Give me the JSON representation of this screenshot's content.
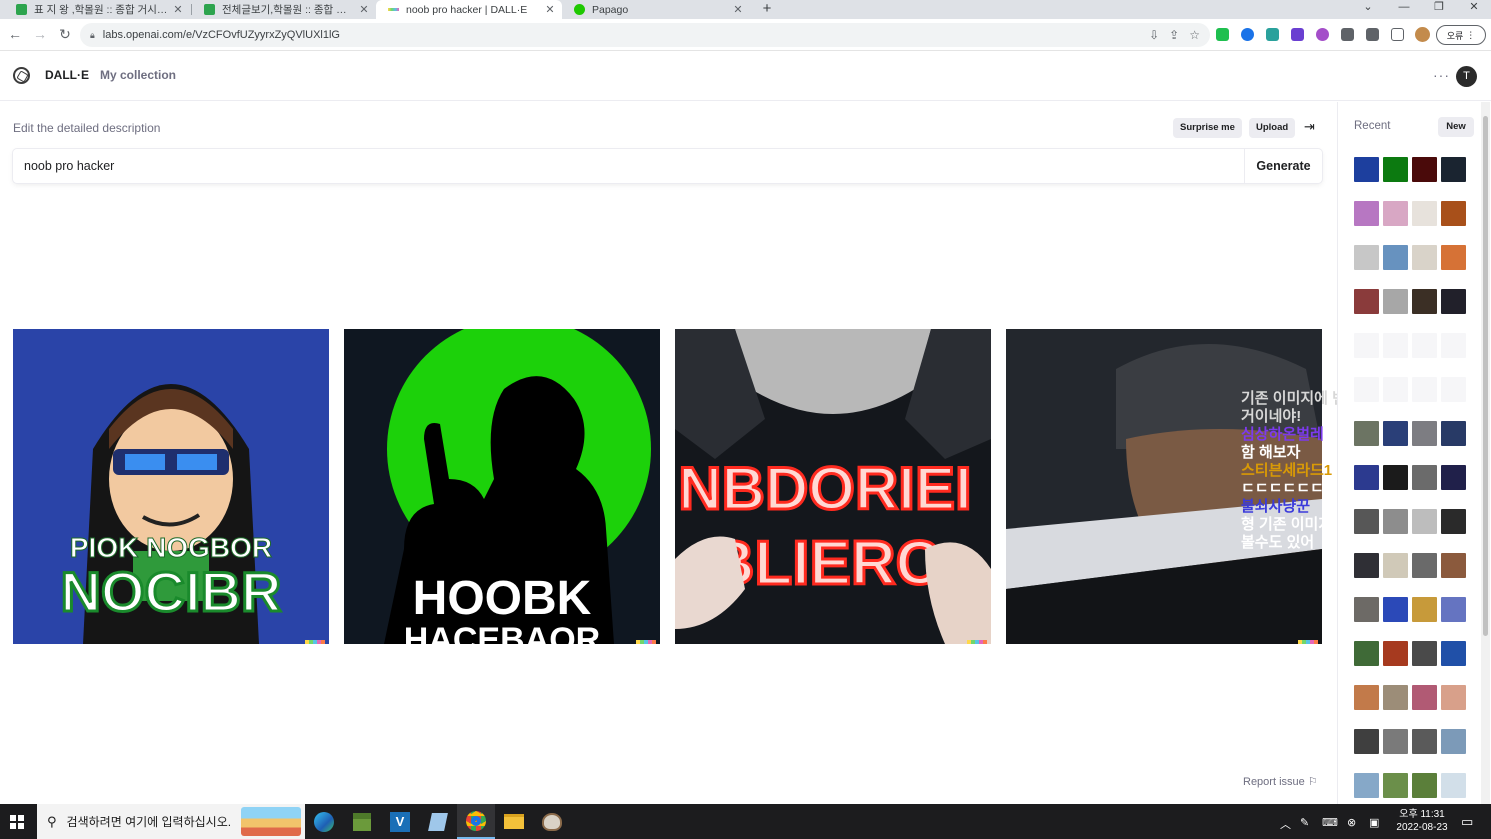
{
  "browser": {
    "tabs": [
      {
        "title": "표 지 왕 ,학몰원 :: 종합 거시기 ::",
        "favicon_color": "#2da44e",
        "active": false
      },
      {
        "title": "전체글보기,학몰원 :: 종합 거시기 ::",
        "favicon_color": "#2da44e",
        "active": false
      },
      {
        "title": "noob pro hacker | DALL·E",
        "favicon_color": "#10a37f",
        "active": true
      },
      {
        "title": "Papago",
        "favicon_color": "#1ec800",
        "active": false
      }
    ],
    "tab_close_glyph": "✕",
    "new_tab_glyph": "+",
    "url": "labs.openai.com/e/VzCFOvfUZyyrxZyQVlUXl1lG",
    "profile_label": "오류"
  },
  "app": {
    "brand": "DALL·E",
    "nav_collection": "My collection",
    "avatar_initial": "T",
    "more_glyph": "···"
  },
  "editor": {
    "description_label": "Edit the detailed description",
    "surprise_label": "Surprise me",
    "upload_label": "Upload",
    "prompt_value": "noob pro hacker",
    "generate_label": "Generate",
    "report_label": "Report issue"
  },
  "images": [
    {
      "caption_line1": "PIOK NOGBOR",
      "caption_line2": "NOCIBR"
    },
    {
      "caption_line1": "HOOBK",
      "caption_line2": "HACEBAOR"
    },
    {
      "caption_line1": "NBDORIEI",
      "caption_line2": "BLIERC"
    },
    {
      "caption_line1": "",
      "caption_line2": ""
    }
  ],
  "overlay_chat": [
    {
      "text": "기존 이미지에 변화를 주는",
      "color": "#d7d7d7"
    },
    {
      "text": "거이네야!",
      "color": "#d7d7d7"
    },
    {
      "text": "심상하온벌레",
      "color": "#7c3aed"
    },
    {
      "text": "함 해보자",
      "color": "#ffffff"
    },
    {
      "text": "스티븐세라드1",
      "color": "#d99a06"
    },
    {
      "text": "ㄷㄷㄷㄷㄷㄷ",
      "color": "#ffffff"
    },
    {
      "text": "불쇠사냥꾼",
      "color": "#3b3bdb"
    },
    {
      "text": "형 기존 이미지 올려서 바리에이션",
      "color": "#ffffff"
    },
    {
      "text": "볼수도 있어",
      "color": "#ffffff"
    }
  ],
  "sidebar": {
    "recent_label": "Recent",
    "new_label": "New",
    "thumbnail_rows": [
      [
        "#1d3f9e",
        "#0c7a10",
        "#4a0a0a",
        "#1a2430"
      ],
      [
        "#b777c2",
        "#d8a7c4",
        "#e7e2dc",
        "#a8501a"
      ],
      [
        "#c7c7c7",
        "#6792bf",
        "#d9d3c9",
        "#d67236"
      ],
      [
        "#8a3b3b",
        "#a7a7a7",
        "#3b2f25",
        "#21202a"
      ],
      [
        "#f6f6f8",
        "#f6f6f8",
        "#f6f6f8",
        "#f6f6f8"
      ],
      [
        "#f6f6f8",
        "#f6f6f8",
        "#f6f6f8",
        "#f6f6f8"
      ],
      [
        "#6c7463",
        "#2a3f78",
        "#7d7d82",
        "#283a66"
      ],
      [
        "#2c3a8f",
        "#1b1b1b",
        "#6b6b6b",
        "#20204a"
      ],
      [
        "#575757",
        "#8d8d8d",
        "#bdbdbd",
        "#2a2a2a"
      ],
      [
        "#2f2f35",
        "#d0c9b8",
        "#6a6a6a",
        "#8b5a3d"
      ],
      [
        "#6d6a66",
        "#2b49b8",
        "#c79a3a",
        "#6574c1"
      ],
      [
        "#3f6a37",
        "#a63a1f",
        "#4a4a4a",
        "#2050a8"
      ],
      [
        "#c27a4a",
        "#9c8d78",
        "#b15a74",
        "#d8a08a"
      ],
      [
        "#3f3f3f",
        "#7a7a7a",
        "#5a5a5a",
        "#7c9ab8"
      ],
      [
        "#86a8c8",
        "#6b8f4a",
        "#5b7f3a",
        "#d2dfe9"
      ]
    ]
  },
  "taskbar": {
    "search_placeholder": "검색하려면 여기에 입력하십시오.",
    "time": "오후 11:31",
    "date": "2022-08-23"
  },
  "colors": {
    "accent": "#10a37f",
    "chrome_bg": "#dee1e6",
    "taskbar_bg": "#1c1c1e"
  }
}
